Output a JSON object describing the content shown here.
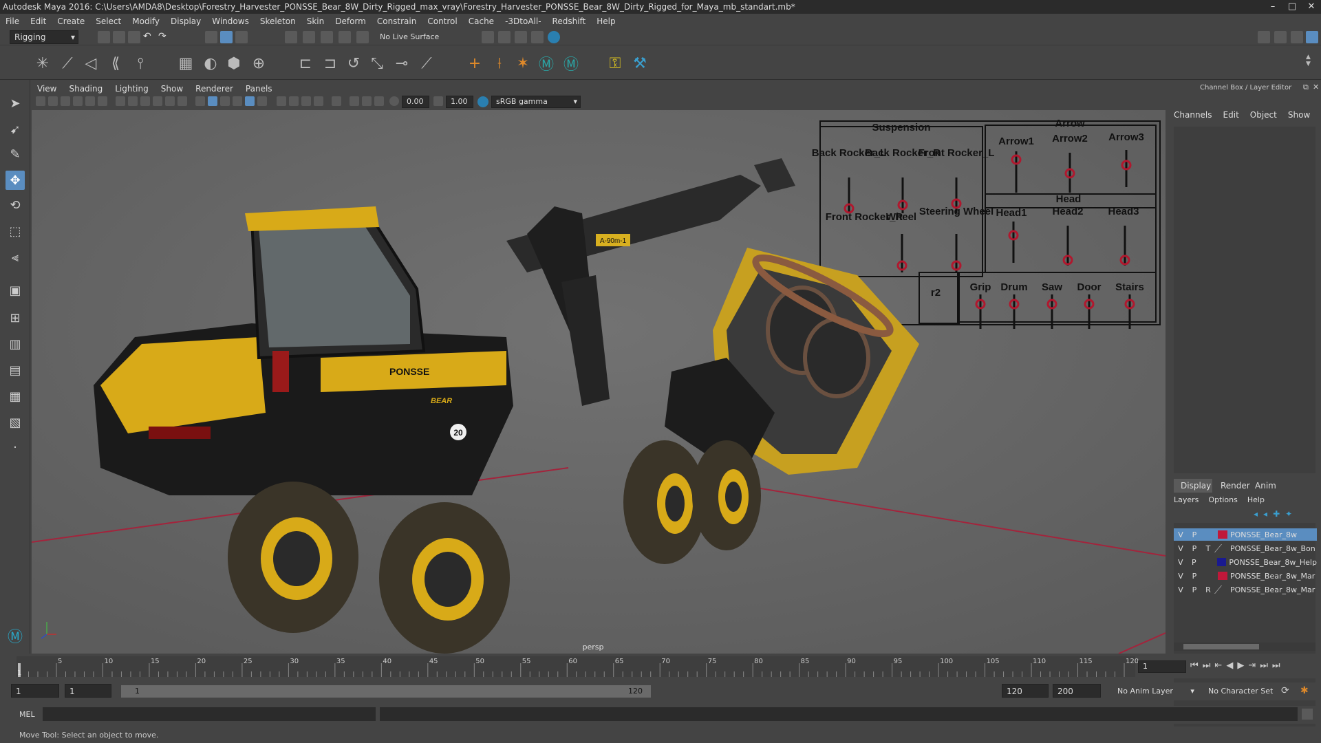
{
  "window": {
    "title": "Autodesk Maya 2016: C:\\Users\\AMDA8\\Desktop\\Forestry_Harvester_PONSSE_Bear_8W_Dirty_Rigged_max_vray\\Forestry_Harvester_PONSSE_Bear_8W_Dirty_Rigged_for_Maya_mb_standart.mb*",
    "minimize": "–",
    "maximize": "□",
    "close": "✕"
  },
  "menubar": [
    "File",
    "Edit",
    "Create",
    "Select",
    "Modify",
    "Display",
    "Windows",
    "Skeleton",
    "Skin",
    "Deform",
    "Constrain",
    "Control",
    "Cache",
    "-3DtoAll-",
    "Redshift",
    "Help"
  ],
  "shelf": {
    "mode": "Rigging",
    "live_surface": "No Live Surface"
  },
  "viewport": {
    "menu": [
      "View",
      "Shading",
      "Lighting",
      "Show",
      "Renderer",
      "Panels"
    ],
    "near_value": "0.00",
    "far_value": "1.00",
    "color_space": "sRGB gamma",
    "camera_label": "persp"
  },
  "rig_panel": {
    "suspension_title": "Suspension",
    "suspension_items": [
      "Back Rocker_L",
      "Back Rocker_R",
      "Front Rocker_L"
    ],
    "lower_items": [
      "Front Rocker_R",
      "Wheel",
      "Steering Wheel"
    ],
    "arrow_title": "Arrow",
    "arrow_items": [
      "Arrow1",
      "Arrow2",
      "Arrow3"
    ],
    "head_title": "Head",
    "head_items": [
      "Head1",
      "Head2",
      "Head3"
    ],
    "bottom_items": [
      "Grip",
      "Drum",
      "Saw",
      "Door",
      "Stairs"
    ],
    "partial_label": "r2"
  },
  "vehicle": {
    "brand": "PONSSE",
    "model": "BEAR",
    "number": "20",
    "boom_label": "A-90m-1"
  },
  "channel_box": {
    "title": "Channel Box / Layer Editor",
    "menu": [
      "Channels",
      "Edit",
      "Object",
      "Show"
    ],
    "tabs": [
      "Display",
      "Render",
      "Anim"
    ],
    "layer_menu": [
      "Layers",
      "Options",
      "Help"
    ],
    "layers": [
      {
        "v": "V",
        "p": "P",
        "t": "",
        "name": "PONSSE_Bear_8w",
        "color": "#c0183a",
        "selected": true
      },
      {
        "v": "V",
        "p": "P",
        "t": "T",
        "name": "PONSSE_Bear_8w_Bon",
        "color": "",
        "selected": false
      },
      {
        "v": "V",
        "p": "P",
        "t": "",
        "name": "PONSSE_Bear_8w_Help",
        "color": "#1a1a90",
        "selected": false
      },
      {
        "v": "V",
        "p": "P",
        "t": "",
        "name": "PONSSE_Bear_8w_Mar",
        "color": "#c0183a",
        "selected": false
      },
      {
        "v": "V",
        "p": "P",
        "t": "R",
        "name": "PONSSE_Bear_8w_Mar",
        "color": "",
        "selected": false
      }
    ]
  },
  "timeline": {
    "ticks": [
      "5",
      "10",
      "15",
      "20",
      "25",
      "30",
      "35",
      "40",
      "45",
      "50",
      "55",
      "60",
      "65",
      "70",
      "75",
      "80",
      "85",
      "90",
      "95",
      "100",
      "105",
      "110",
      "115",
      "120"
    ],
    "start_label": "1",
    "current_frame": "1"
  },
  "range": {
    "start": "1",
    "start2": "1",
    "range_start": "1",
    "range_end": "120",
    "end": "120",
    "end2": "200",
    "anim_layer": "No Anim Layer",
    "char_set": "No Character Set"
  },
  "cmdline": {
    "label": "MEL"
  },
  "helpline": {
    "text": "Move Tool: Select an object to move."
  }
}
